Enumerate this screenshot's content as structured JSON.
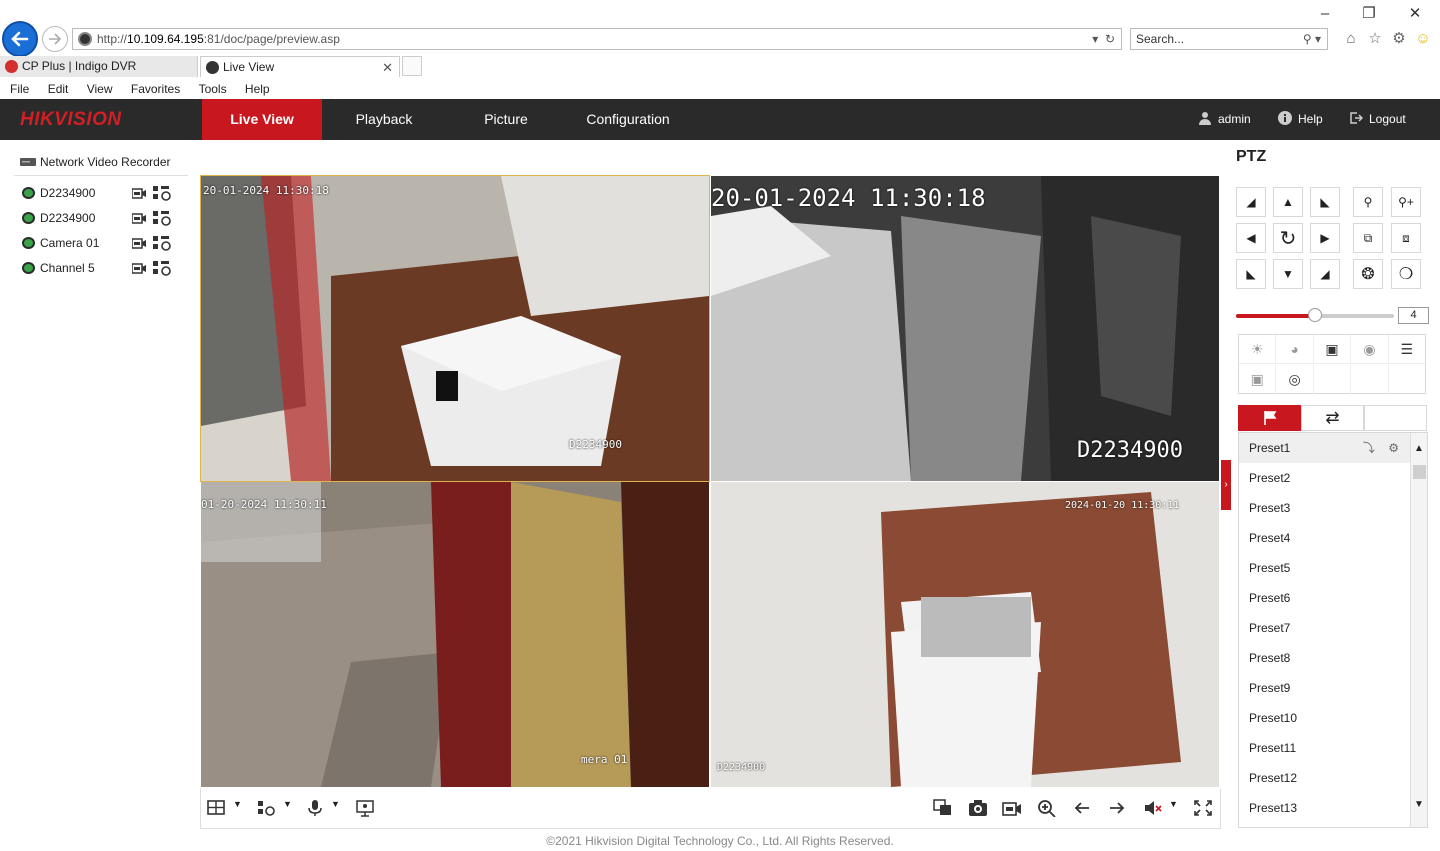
{
  "browser": {
    "url_prefix": "http://",
    "url_host": "10.109.64.195",
    "url_rest": ":81/doc/page/preview.asp",
    "search_placeholder": "Search...",
    "tabs": [
      {
        "label": "CP Plus | Indigo DVR"
      },
      {
        "label": "Live View"
      }
    ],
    "menu": [
      "File",
      "Edit",
      "View",
      "Favorites",
      "Tools",
      "Help"
    ]
  },
  "app": {
    "brand": "HIKVISION",
    "nav": [
      {
        "label": "Live View",
        "active": true
      },
      {
        "label": "Playback"
      },
      {
        "label": "Picture"
      },
      {
        "label": "Configuration"
      }
    ],
    "user": "admin",
    "help_label": "Help",
    "logout_label": "Logout",
    "accent_color": "#c8171e"
  },
  "device_tree": {
    "root": "Network Video Recorder",
    "cameras": [
      {
        "label": "D2234900"
      },
      {
        "label": "D2234900"
      },
      {
        "label": "Camera 01"
      },
      {
        "label": "Channel 5"
      }
    ]
  },
  "video": {
    "windows": [
      {
        "timestamp": "20-01-2024 11:30:18",
        "name": "D2234900",
        "selected": true
      },
      {
        "timestamp": "20-01-2024 11:30:18",
        "name": "D2234900"
      },
      {
        "timestamp": "01-20-2024 11:30:11",
        "name": "mera 01"
      },
      {
        "timestamp": "2024-01-20 11:30:11",
        "name": "D2234900"
      }
    ]
  },
  "ptz": {
    "title": "PTZ",
    "speed": "4",
    "speed_fraction": 0.5,
    "presets": [
      "Preset1",
      "Preset2",
      "Preset3",
      "Preset4",
      "Preset5",
      "Preset6",
      "Preset7",
      "Preset8",
      "Preset9",
      "Preset10",
      "Preset11",
      "Preset12",
      "Preset13"
    ]
  },
  "footer": "©2021 Hikvision Digital Technology Co., Ltd. All Rights Reserved."
}
